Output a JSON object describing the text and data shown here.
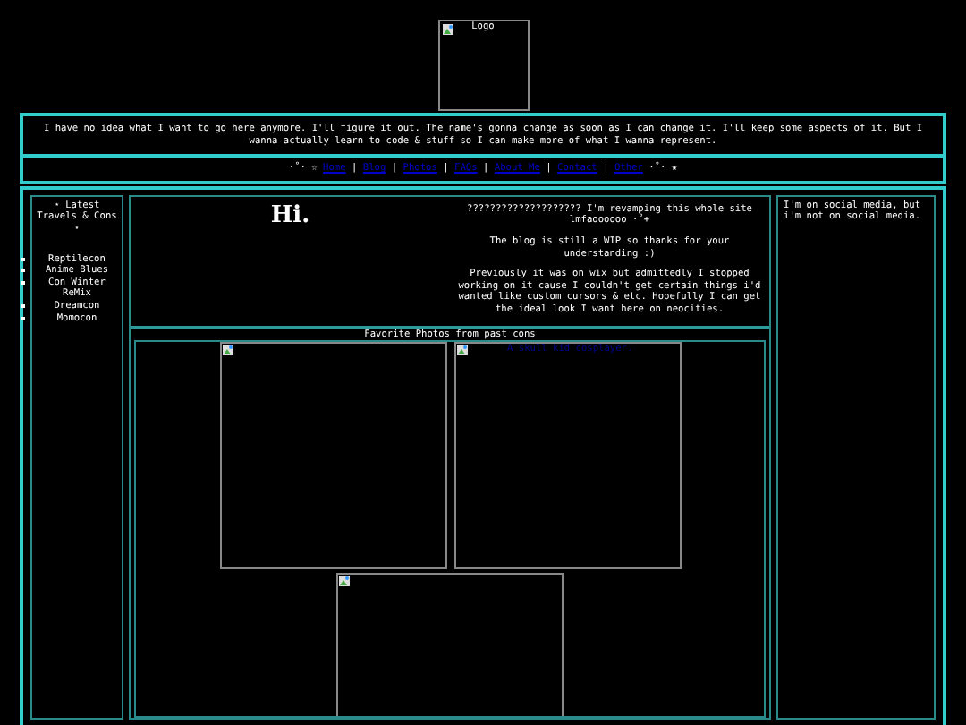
{
  "logo": {
    "alt": "Logo"
  },
  "intro": "I have no idea what I want to go here anymore. I'll figure it out. The name's gonna change as soon as I can change it. I'll keep some aspects of it. But I wanna actually learn to code & stuff so I can make more of what I wanna represent.",
  "nav": {
    "lead": "·˚· ☆",
    "separator": "|",
    "trail": "·˚· ★",
    "links": [
      "Home",
      "Blog",
      "Photos",
      "FAQs",
      "About Me",
      "Contact",
      "Other"
    ]
  },
  "sidebar": {
    "title": "⋆ Latest Travels & Cons ⋆",
    "items": [
      "Reptilecon",
      "Anime Blues",
      "Con Winter ReMix",
      "Dreamcon",
      "Momocon"
    ]
  },
  "main": {
    "heading": "Hi.",
    "paragraphs": [
      "???????????????????? I'm revamping this whole site lmfaoooooo ·˚+",
      "The blog is still a WIP so thanks for your understanding :)",
      "Previously it was on wix but admittedly I stopped working on it cause I couldn't get certain things i'd wanted like custom cursors & etc. Hopefully I can get the ideal look I want here on neocities."
    ]
  },
  "gallery": {
    "title": "Favorite Photos from past cons",
    "photos": [
      {
        "kind": "broken-image"
      },
      {
        "kind": "broken-image",
        "alt": "A skull kid cosplayer."
      },
      {
        "kind": "broken-image"
      }
    ]
  },
  "aside": {
    "text": "I'm on social media, but i'm not on social media."
  }
}
